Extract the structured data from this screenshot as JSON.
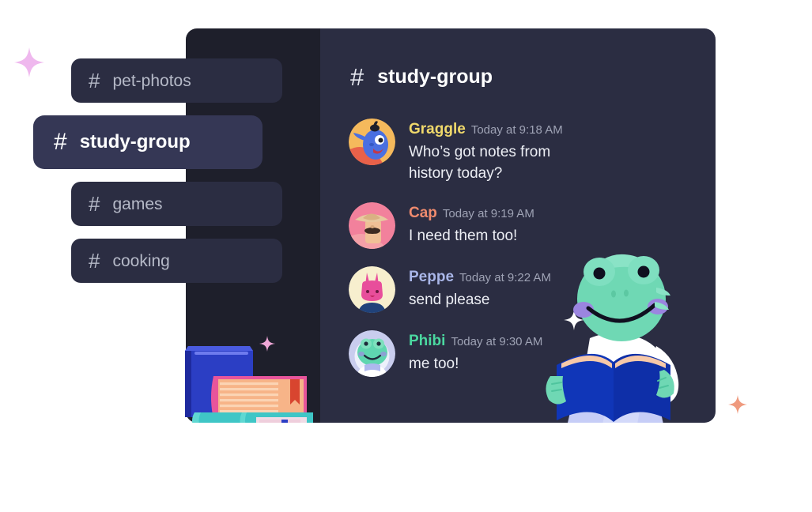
{
  "window": {
    "sidebar": {
      "channels": [
        {
          "name": "pet-photos",
          "hash": "#",
          "active": false
        },
        {
          "name": "study-group",
          "hash": "#",
          "active": true
        },
        {
          "name": "games",
          "hash": "#",
          "active": false
        },
        {
          "name": "cooking",
          "hash": "#",
          "active": false
        }
      ]
    },
    "chat": {
      "header": {
        "hash": "#",
        "channel": "study-group"
      },
      "messages": [
        {
          "author": "Graggle",
          "author_color": "#F0D96B",
          "timestamp": "Today at 9:18 AM",
          "text": "Who’s got notes from history today?",
          "avatar": "genie-avatar"
        },
        {
          "author": "Cap",
          "author_color": "#F08B6E",
          "timestamp": "Today at 9:19 AM",
          "text": "I need them too!",
          "avatar": "cowboy-avatar"
        },
        {
          "author": "Peppe",
          "author_color": "#A9B6E8",
          "timestamp": "Today at 9:22 AM",
          "text": "send please",
          "avatar": "bunny-avatar"
        },
        {
          "author": "Phibi",
          "author_color": "#4BD8A0",
          "timestamp": "Today at 9:30 AM",
          "text": "me too!",
          "avatar": "frog-avatar"
        }
      ]
    }
  },
  "decorations": {
    "sparkle_pink": "#EFB8EE",
    "sparkle_white": "#FFFFFF",
    "sparkle_coral": "#EF9A7E"
  },
  "colors": {
    "page_background": "#FFFFFF",
    "sidebar_panel": "#1E1F2B",
    "chat_panel": "#2B2D42",
    "chip_inactive": "#2B2D42",
    "chip_active": "#353755",
    "chip_text": "#B6BAC8",
    "chip_active_text": "#FFFFFF",
    "message_text": "#EDEFF5",
    "timestamp_text": "#9FA3B5"
  }
}
